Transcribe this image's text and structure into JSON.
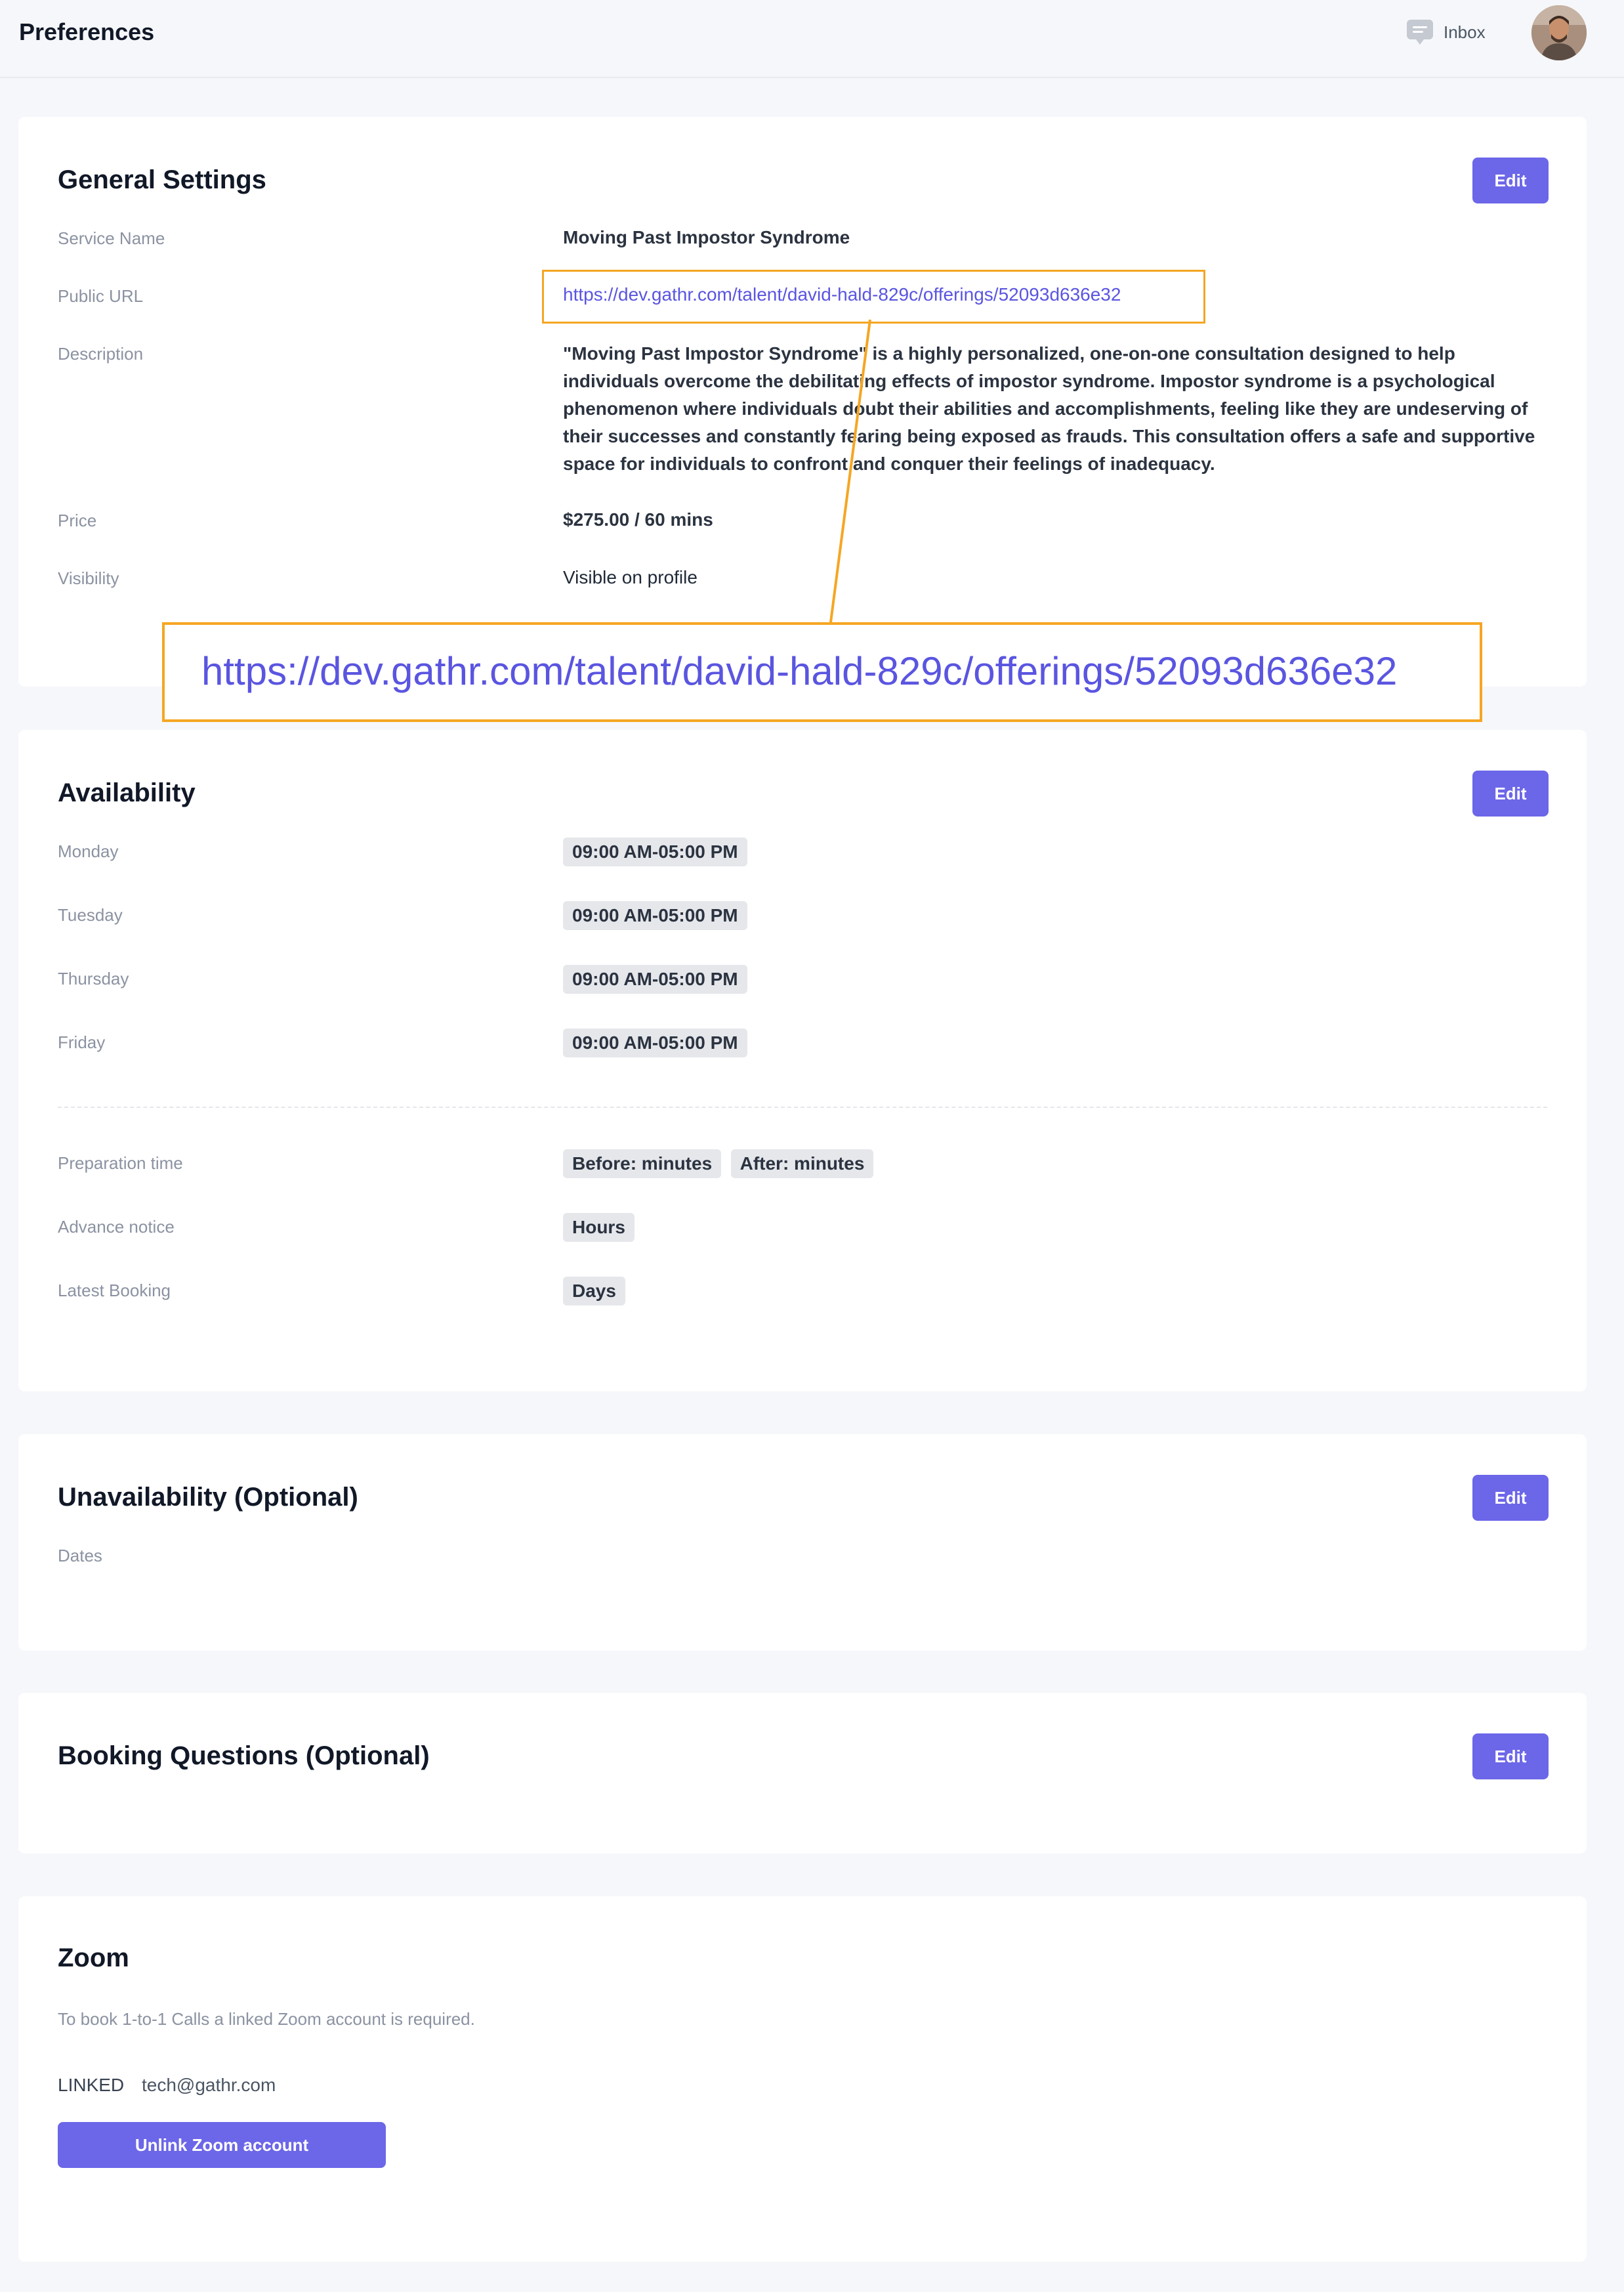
{
  "header": {
    "title": "Preferences",
    "inbox_label": "Inbox",
    "inbox_icon": "chat-bubble-icon",
    "avatar_icon": "user-avatar"
  },
  "general": {
    "title": "General Settings",
    "edit_label": "Edit",
    "service_name_label": "Service Name",
    "service_name": "Moving Past Impostor Syndrome",
    "public_url_label": "Public URL",
    "public_url": "https://dev.gathr.com/talent/david-hald-829c/offerings/52093d636e32",
    "description_label": "Description",
    "description": "\"Moving Past Impostor Syndrome\" is a highly personalized, one-on-one consultation designed to help individuals overcome the debilitating effects of impostor syndrome. Impostor syndrome is a psychological phenomenon where individuals doubt their abilities and accomplishments, feeling like they are undeserving of their successes and constantly fearing being exposed as frauds. This consultation offers a safe and supportive space for individuals to confront and conquer their feelings of inadequacy.",
    "price_label": "Price",
    "price": "$275.00 / 60 mins",
    "visibility_label": "Visibility",
    "visibility": "Visible on profile"
  },
  "availability": {
    "title": "Availability",
    "edit_label": "Edit",
    "days": [
      {
        "day": "Monday",
        "hours": "09:00 AM-05:00 PM"
      },
      {
        "day": "Tuesday",
        "hours": "09:00 AM-05:00 PM"
      },
      {
        "day": "Thursday",
        "hours": "09:00 AM-05:00 PM"
      },
      {
        "day": "Friday",
        "hours": "09:00 AM-05:00 PM"
      }
    ],
    "preparation_label": "Preparation time",
    "preparation_before": "Before: minutes",
    "preparation_after": "After: minutes",
    "advance_label": "Advance notice",
    "advance_value": "Hours",
    "latest_label": "Latest Booking",
    "latest_value": "Days"
  },
  "unavailability": {
    "title": "Unavailability (Optional)",
    "edit_label": "Edit",
    "dates_label": "Dates"
  },
  "booking": {
    "title": "Booking Questions (Optional)",
    "edit_label": "Edit"
  },
  "zoom": {
    "title": "Zoom",
    "note": "To book 1-to-1 Calls a linked Zoom account is required.",
    "linked_label": "LINKED",
    "linked_email": "tech@gathr.com",
    "unlink_label": "Unlink Zoom account"
  },
  "callout": {
    "text": "https://dev.gathr.com/talent/david-hald-829c/offerings/52093d636e32"
  },
  "colors": {
    "accent": "#6c66e8",
    "link": "#5a55e0",
    "highlight": "#f5a623",
    "background": "#f5f7fa"
  }
}
